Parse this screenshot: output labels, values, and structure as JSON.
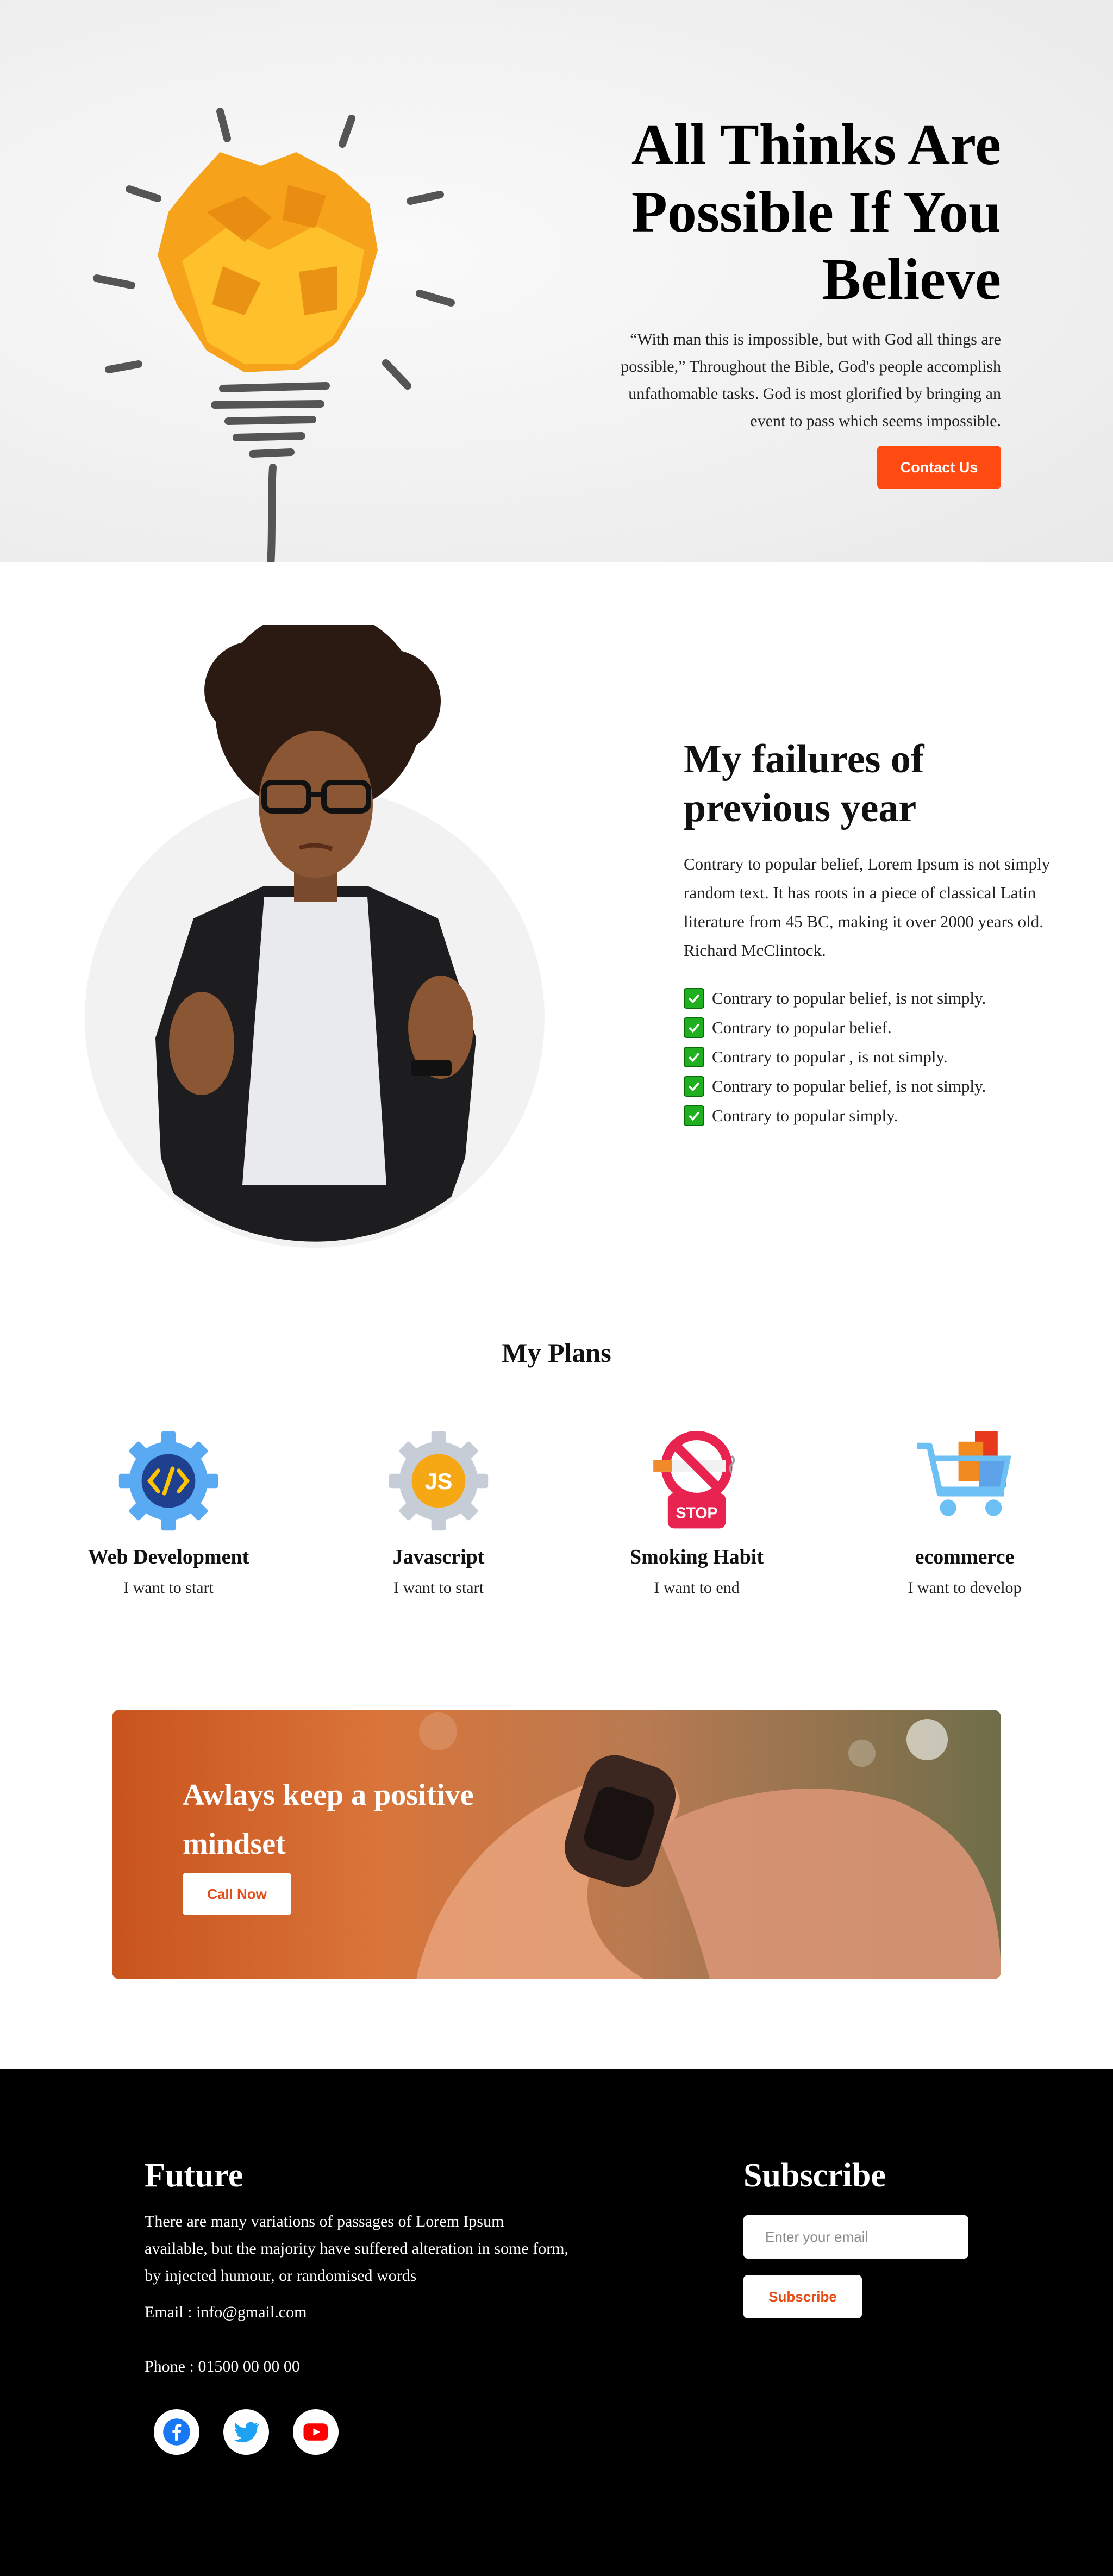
{
  "hero": {
    "title": "All Thinks Are Possible If You Believe",
    "quote": "“With man this is impossible, but with God all things are possible,” Throughout the Bible, God's people accomplish unfathomable tasks. God is most glorified by bringing an event to pass which seems impossible.",
    "cta_label": "Contact Us",
    "accent_color": "#ff4b12",
    "illustration": "crumpled-paper-lightbulb"
  },
  "failures": {
    "title": "My failures of previous year",
    "text": "Contrary to popular belief, Lorem Ipsum is not simply random text. It has roots in a piece of classical Latin literature from 45 BC, making it over 2000 years old. Richard McClintock.",
    "items": [
      "Contrary to popular belief, is not simply.",
      "Contrary to popular belief.",
      "Contrary to popular , is not simply.",
      "Contrary to popular belief, is not simply.",
      "Contrary to popular simply."
    ],
    "check_icon": "green-check-box-icon",
    "photo": "woman-with-glasses-gesturing"
  },
  "plans": {
    "title": "My Plans",
    "items": [
      {
        "icon": "web-development-gear-icon",
        "title": "Web Development",
        "subtitle": "I want to start"
      },
      {
        "icon": "javascript-gear-icon",
        "title": "Javascript",
        "subtitle": "I want to start"
      },
      {
        "icon": "no-smoking-stop-icon",
        "title": "Smoking Habit",
        "subtitle": "I want to end"
      },
      {
        "icon": "shopping-cart-icon",
        "title": "ecommerce",
        "subtitle": "I want to develop"
      }
    ]
  },
  "banner": {
    "title": "Awlays keep a positive mindset",
    "cta_label": "Call Now",
    "photo": "hands-with-smartwatch"
  },
  "footer": {
    "brand": "Future",
    "text": "There are many variations of passages of Lorem Ipsum available, but the majority have suffered alteration in some form, by injected humour, or randomised words",
    "email": "Email : info@gmail.com",
    "phone": "Phone : 01500 00 00 00",
    "social": [
      "facebook-icon",
      "twitter-icon",
      "youtube-icon"
    ],
    "subscribe_title": "Subscribe",
    "email_placeholder": "Enter your email",
    "subscribe_label": "Subscribe"
  }
}
